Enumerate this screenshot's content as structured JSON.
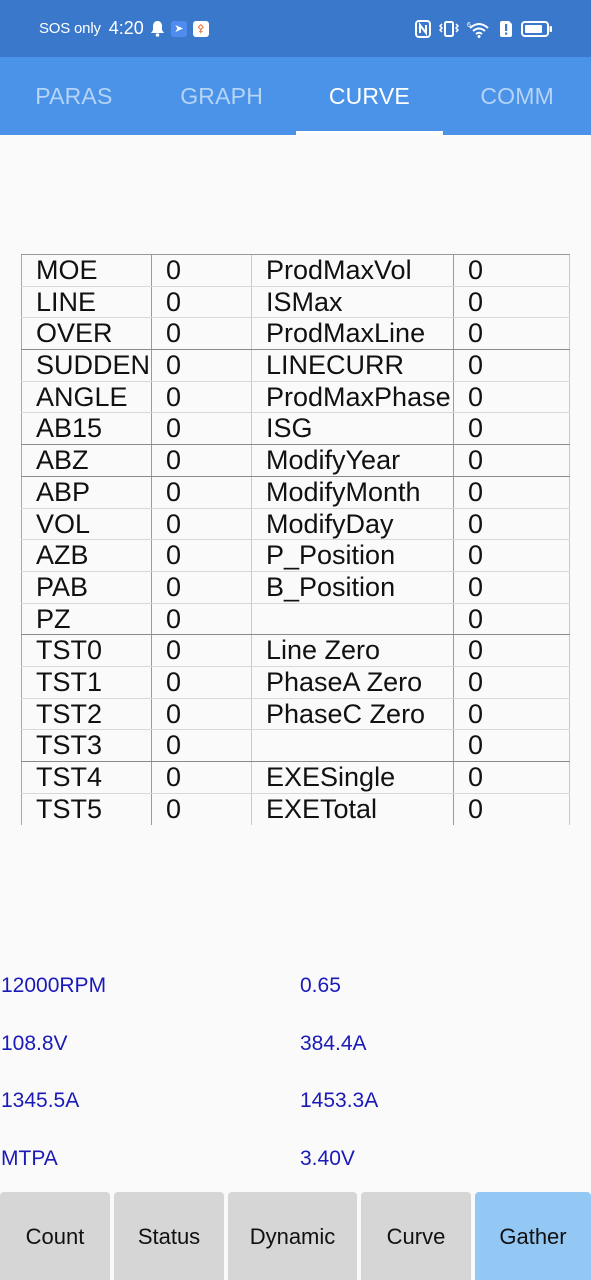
{
  "status_bar": {
    "carrier": "SOS only",
    "time": "4:20",
    "left_icons": [
      "bell-icon",
      "app-icon-bird",
      "app-icon-runner"
    ],
    "right_icons": [
      "nfc-icon",
      "vibrate-icon",
      "wifi-icon",
      "alert-icon",
      "battery-icon"
    ],
    "wifi_badge": "6"
  },
  "tabs": [
    {
      "label": "PARAS",
      "active": false
    },
    {
      "label": "GRAPH",
      "active": false
    },
    {
      "label": "CURVE",
      "active": true
    },
    {
      "label": "COMM",
      "active": false
    }
  ],
  "table": {
    "rows": [
      {
        "k1": "MOE",
        "v1": "0",
        "k2": "ProdMaxVol",
        "v2": "0"
      },
      {
        "k1": "LINE",
        "v1": "0",
        "k2": "ISMax",
        "v2": "0"
      },
      {
        "k1": "OVER",
        "v1": "0",
        "k2": "ProdMaxLine",
        "v2": "0"
      },
      {
        "k1": "SUDDEN",
        "v1": "0",
        "k2": "LINECURR",
        "v2": "0"
      },
      {
        "k1": "ANGLE",
        "v1": "0",
        "k2": "ProdMaxPhase",
        "v2": "0"
      },
      {
        "k1": "AB15",
        "v1": "0",
        "k2": "ISG",
        "v2": "0"
      },
      {
        "k1": "ABZ",
        "v1": "0",
        "k2": "ModifyYear",
        "v2": "0"
      },
      {
        "k1": "ABP",
        "v1": "0",
        "k2": "ModifyMonth",
        "v2": "0"
      },
      {
        "k1": "VOL",
        "v1": "0",
        "k2": "ModifyDay",
        "v2": "0"
      },
      {
        "k1": "AZB",
        "v1": "0",
        "k2": "P_Position",
        "v2": "0"
      },
      {
        "k1": "PAB",
        "v1": "0",
        "k2": "B_Position",
        "v2": "0"
      },
      {
        "k1": "PZ",
        "v1": "0",
        "k2": "",
        "v2": "0"
      },
      {
        "k1": "TST0",
        "v1": "0",
        "k2": "Line Zero",
        "v2": "0"
      },
      {
        "k1": "TST1",
        "v1": "0",
        "k2": "PhaseA Zero",
        "v2": "0"
      },
      {
        "k1": "TST2",
        "v1": "0",
        "k2": "PhaseC Zero",
        "v2": "0"
      },
      {
        "k1": "TST3",
        "v1": "0",
        "k2": "",
        "v2": "0"
      },
      {
        "k1": "TST4",
        "v1": "0",
        "k2": "EXESingle",
        "v2": "0"
      },
      {
        "k1": "TST5",
        "v1": "0",
        "k2": "EXETotal",
        "v2": "0"
      }
    ]
  },
  "readouts": [
    {
      "left": "12000RPM",
      "right": "0.65"
    },
    {
      "left": "108.8V",
      "right": "384.4A"
    },
    {
      "left": "1345.5A",
      "right": "1453.3A"
    },
    {
      "left": "MTPA",
      "right": "3.40V"
    }
  ],
  "bottom_buttons": [
    {
      "label": "Count",
      "active": false
    },
    {
      "label": "Status",
      "active": false
    },
    {
      "label": "Dynamic",
      "active": false
    },
    {
      "label": "Curve",
      "active": false
    },
    {
      "label": "Gather",
      "active": true
    }
  ],
  "colors": {
    "status_bar_bg": "#3a78cc",
    "tab_bar_bg": "#4a93e8",
    "tab_inactive_text": "#b5d4f6",
    "readout_text": "#1a1ab8",
    "button_bg": "#d6d6d6",
    "button_active_bg": "#93c7f4"
  }
}
